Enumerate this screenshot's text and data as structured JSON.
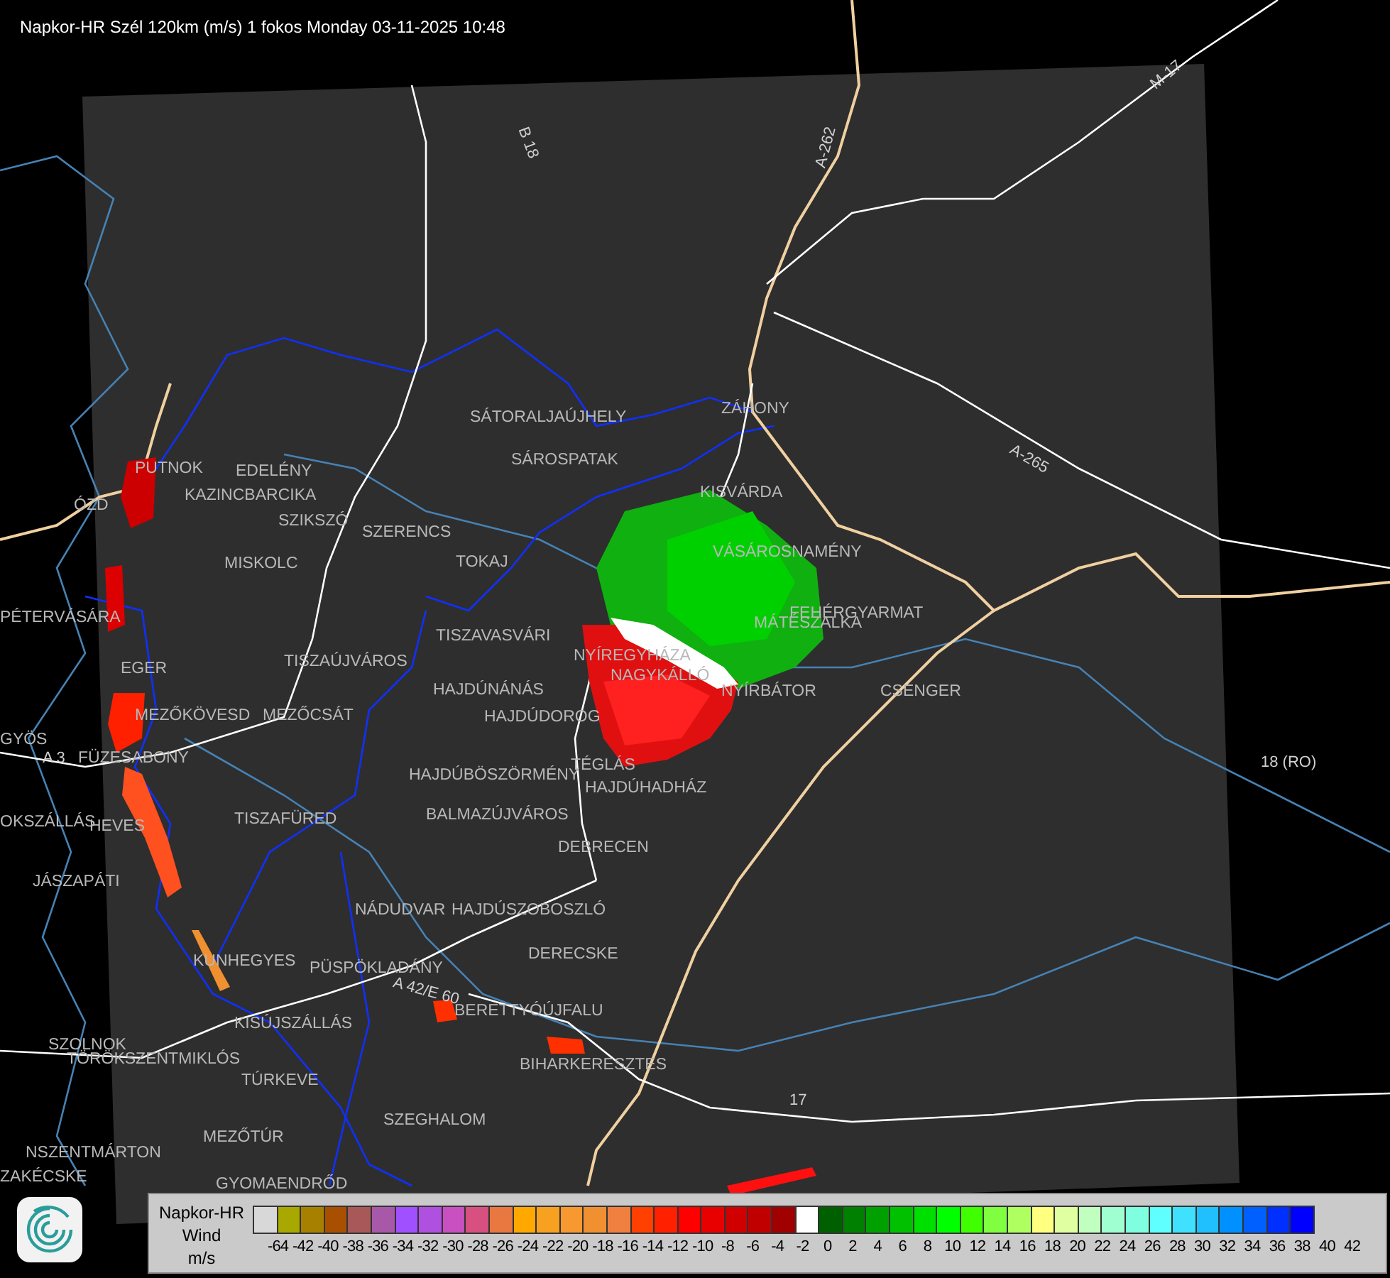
{
  "title": "Napkor-HR Szél 120km (m/s) 1 fokos Monday 03-11-2025 10:48",
  "places": [
    "SÁTORALJAÚJHELY",
    "ZÁHONY",
    "SÁROSPATAK",
    "KISVÁRDA",
    "PUTNOK",
    "EDELÉNY",
    "KAZINCBARCIKA",
    "SZIKSZÓ",
    "SZERENCS",
    "ÓZD",
    "VÁSÁROSNAMÉNY",
    "TOKAJ",
    "MISKOLC",
    "FEHÉRGYARMAT",
    "MÁTÉSZALKA",
    "PÉTERVÁSÁRA",
    "TISZAVASVÁRI",
    "NYÍREGYHÁZA",
    "NAGYKÁLLÓ",
    "EGER",
    "TISZAÚJVÁROS",
    "HAJDÚNÁNÁS",
    "NYÍRBÁTOR",
    "CSENGER",
    "MEZŐKÖVESD",
    "MEZŐCSÁT",
    "HAJDÚDOROG",
    "GYÖS",
    "FÜZESABONY",
    "TÉGLÁS",
    "HAJDÚBÖSZÖRMÉNY",
    "HAJDÚHADHÁZ",
    "OKSZÁLLÁS",
    "HEVES",
    "TISZAFÜRED",
    "BALMAZÚJVÁROS",
    "DEBRECEN",
    "JÁSZAPÁTI",
    "NÁDUDVAR",
    "HAJDÚSZOBOSZLÓ",
    "KUNHEGYES",
    "PÜSPÖKLADÁNY",
    "DERECSKE",
    "BERETTYÓÚJFALU",
    "KISÚJSZÁLLÁS",
    "SZOLNOK",
    "TÖRÖKSZENTMIKLÓS",
    "BIHARKERESZTES",
    "TÚRKEVE",
    "SZEGHALOM",
    "MEZŐTÚR",
    "ZAKÉCSKE",
    "GYOMAENDRŐD",
    "NSZENTMÁRTON"
  ],
  "road_labels": [
    "B 18",
    "A-262",
    "M-17",
    "A-265",
    "18 (RO)",
    "17",
    "A 42/E 60",
    "A 3"
  ],
  "legend": {
    "title": "Napkor-HR",
    "subtitle": "Wind",
    "unit": "m/s",
    "swatches": [
      {
        "color": "#d8d8d8"
      },
      {
        "color": "#a8a800"
      },
      {
        "color": "#a88000"
      },
      {
        "color": "#a85000"
      },
      {
        "color": "#a85858"
      },
      {
        "color": "#a858a8"
      },
      {
        "color": "#a050ff"
      },
      {
        "color": "#b050e0"
      },
      {
        "color": "#c850c0"
      },
      {
        "color": "#d85080"
      },
      {
        "color": "#e87840"
      },
      {
        "color": "#ffa800"
      },
      {
        "color": "#f8a020"
      },
      {
        "color": "#f89830"
      },
      {
        "color": "#f09030"
      },
      {
        "color": "#f08040"
      },
      {
        "color": "#ff4000"
      },
      {
        "color": "#ff2000"
      },
      {
        "color": "#ff0000"
      },
      {
        "color": "#e80000"
      },
      {
        "color": "#d00000"
      },
      {
        "color": "#c00000"
      },
      {
        "color": "#a00000"
      },
      {
        "color": "#ffffff"
      },
      {
        "color": "#006000"
      },
      {
        "color": "#008000"
      },
      {
        "color": "#00a000"
      },
      {
        "color": "#00c000"
      },
      {
        "color": "#00e000"
      },
      {
        "color": "#00ff00"
      },
      {
        "color": "#40ff00"
      },
      {
        "color": "#80ff40"
      },
      {
        "color": "#b0ff60"
      },
      {
        "color": "#ffff80"
      },
      {
        "color": "#e0ffa0"
      },
      {
        "color": "#c0ffc0"
      },
      {
        "color": "#a0ffd0"
      },
      {
        "color": "#80ffe0"
      },
      {
        "color": "#60ffff"
      },
      {
        "color": "#40e0ff"
      },
      {
        "color": "#20c0ff"
      },
      {
        "color": "#0090ff"
      },
      {
        "color": "#0060ff"
      },
      {
        "color": "#0030ff"
      },
      {
        "color": "#0000ff"
      }
    ],
    "ticks": [
      "-64",
      "-42",
      "-40",
      "-38",
      "-36",
      "-34",
      "-32",
      "-30",
      "-28",
      "-26",
      "-24",
      "-22",
      "-20",
      "-18",
      "-16",
      "-14",
      "-12",
      "-10",
      "-8",
      "-6",
      "-4",
      "-2",
      "0",
      "2",
      "4",
      "6",
      "8",
      "10",
      "12",
      "14",
      "16",
      "18",
      "20",
      "22",
      "24",
      "26",
      "28",
      "30",
      "32",
      "34",
      "36",
      "38",
      "40",
      "42"
    ]
  }
}
